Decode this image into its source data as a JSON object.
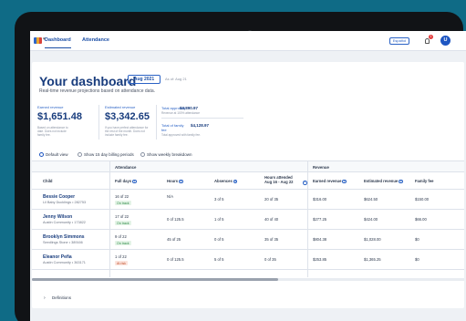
{
  "nav": {
    "tabs": [
      "Dashboard",
      "Attendance"
    ],
    "language_button": "Español",
    "notification_count": "1",
    "avatar_initial": "U"
  },
  "header": {
    "title": "Your dashboard",
    "month": "Aug 2021",
    "as_of": "As of: Aug 21",
    "subtitle": "Real-time revenue projections based on attendance data."
  },
  "stats": {
    "earned": {
      "label": "Earned revenue",
      "value": "$1,651.48",
      "note": "Based on attendance to date. Does not include family fee."
    },
    "estimated": {
      "label": "Estimated revenue",
      "value": "$3,342.65",
      "note": "If you have perfect attendance for the rest of the month. Does not include family fee."
    },
    "approved": {
      "total_label": "Total approved",
      "total_value": "$3,890.97",
      "total_note": "Revenue at 100% attendance",
      "family_label": "Total of family fee",
      "family_value": "$4,128.97",
      "family_note": "Total approved with family fee."
    }
  },
  "view_options": [
    "Default view",
    "Show 15 day billing periods",
    "Show weekly breakdown"
  ],
  "table": {
    "groups": [
      "Attendance",
      "Revenue"
    ],
    "headers": [
      "Child",
      "Full days",
      "Hours",
      "Absences",
      "Hours attended Aug 16 - Aug 22",
      "Earned revenue",
      "Estimated revenue",
      "Family fee"
    ],
    "rows": [
      {
        "name": "Bessie Cooper",
        "location": "Lil Baby Ducklings • 282753",
        "full_days": "16 of 22",
        "status": "On track",
        "status_type": "ok",
        "hours": "N/A",
        "absences": "3 of 5",
        "hours_attended": "20 of 35",
        "earned": "$316.00",
        "estimated": "$624.50",
        "family_fee": "$150.00"
      },
      {
        "name": "Jenny Wilson",
        "location": "Austin Community • 173822",
        "full_days": "17 of 22",
        "status": "On track",
        "status_type": "ok",
        "hours": "0 of 125.5",
        "absences": "1 of 5",
        "hours_attended": "40 of 40",
        "earned": "$277.25",
        "estimated": "$424.00",
        "family_fee": "$66.00"
      },
      {
        "name": "Brooklyn Simmons",
        "location": "Seedlings Stone • 389166",
        "full_days": "9 of 22",
        "status": "On track",
        "status_type": "ok",
        "hours": "45 of 25",
        "absences": "0 of 5",
        "hours_attended": "35 of 35",
        "earned": "$804.38",
        "estimated": "$1,028.00",
        "family_fee": "$0"
      },
      {
        "name": "Eleanor Peña",
        "location": "Austin Community • 363171",
        "full_days": "1 of 22",
        "status": "At risk",
        "status_type": "risk",
        "hours": "0 of 125.5",
        "absences": "5 of 5",
        "hours_attended": "0 of 35",
        "earned": "$253.85",
        "estimated": "$1,365.25",
        "family_fee": "$0"
      }
    ]
  },
  "definitions_label": "Definitions",
  "colors": {
    "accent": "#1e56c2",
    "title": "#183c7d",
    "ok": "#2e8b47",
    "risk": "#c2532f",
    "frame_background": "#0f6b86"
  },
  "icons": [
    "logo-icon",
    "bell-icon",
    "info-icon",
    "chevron-right-icon"
  ]
}
